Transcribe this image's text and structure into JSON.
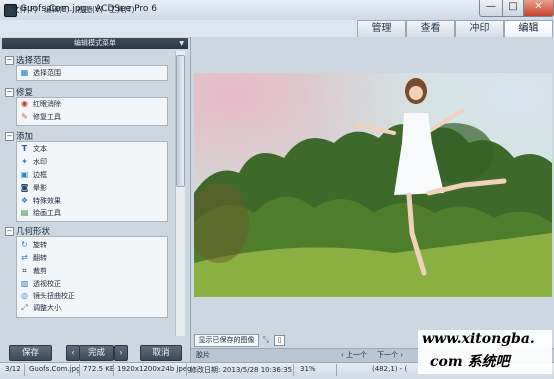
{
  "window": {
    "title": "Guofs.Com.jpg - ACDSee Pro 6",
    "controls": {
      "minimize": "—",
      "maximize": "□",
      "close": "✕"
    }
  },
  "menu": [
    "文件(F)",
    "编辑(E)",
    "视图(V)",
    "工具(T)"
  ],
  "modes": {
    "tabs": [
      "管理",
      "查看",
      "冲印",
      "编辑"
    ],
    "active": "编辑"
  },
  "panel": {
    "header": "编辑模式菜单",
    "sections": [
      {
        "title": "选择范围",
        "toggle": "−",
        "items": [
          {
            "label": "选择范围",
            "icon": "selection-icon"
          }
        ]
      },
      {
        "title": "修复",
        "toggle": "−",
        "items": [
          {
            "label": "红眼消除",
            "icon": "eye-icon"
          },
          {
            "label": "修复工具",
            "icon": "brush-icon"
          }
        ]
      },
      {
        "title": "添加",
        "toggle": "−",
        "items": [
          {
            "label": "文本",
            "icon": "text-icon"
          },
          {
            "label": "水印",
            "icon": "watermark-icon"
          },
          {
            "label": "边框",
            "icon": "border-icon"
          },
          {
            "label": "晕影",
            "icon": "vignette-icon"
          },
          {
            "label": "特殊效果",
            "icon": "effects-icon"
          },
          {
            "label": "绘画工具",
            "icon": "drawing-icon"
          }
        ]
      },
      {
        "title": "几何形状",
        "toggle": "−",
        "items": [
          {
            "label": "旋转",
            "icon": "rotate-icon"
          },
          {
            "label": "翻转",
            "icon": "flip-icon"
          },
          {
            "label": "裁剪",
            "icon": "crop-icon"
          },
          {
            "label": "透视校正",
            "icon": "perspective-icon"
          },
          {
            "label": "镜头扭曲校正",
            "icon": "lens-distortion-icon"
          },
          {
            "label": "调整大小",
            "icon": "resize-icon"
          }
        ]
      }
    ],
    "buttons": {
      "save": "保存",
      "prev": "‹",
      "done": "完成",
      "next": "›",
      "cancel": "取消"
    }
  },
  "viewer": {
    "saved_tab": "显示已保存的图像",
    "filmstrip_label": "胶片",
    "prev_label": "‹ 上一个",
    "next_label": "下一个 ›"
  },
  "status": {
    "index": "3/12",
    "filename": "Guofs.Com.jpg",
    "filesize": "772.5 KB",
    "dimensions": "1920x1200x24b jpeg",
    "modified": "修改日期: 2013/5/28 10:36:35",
    "zoom": "31%",
    "coords": "(482,1) - ("
  },
  "watermark": {
    "line1": "www.xitongba.",
    "line2": "com 系统吧"
  },
  "colors": {
    "panel_bg": "#cdd7e2",
    "accent_dark": "#2a3644",
    "close_red": "#c8412a"
  }
}
